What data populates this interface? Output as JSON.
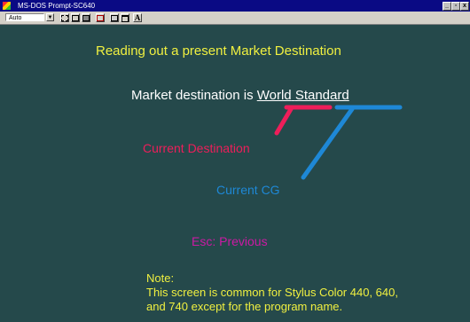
{
  "window": {
    "title": "MS-DOS Prompt-SC640",
    "controls": {
      "minimize": "_",
      "maximize": "▫",
      "close": "x"
    }
  },
  "toolbar": {
    "font_size_value": "Auto",
    "font_button_label": "A"
  },
  "console": {
    "heading": "Reading out a present Market Destination",
    "market_prefix": "Market destination is ",
    "market_world": "World",
    "market_space": " ",
    "market_standard": "Standard",
    "current_destination_label": "Current Destination",
    "current_cg_label": "Current CG",
    "esc_hint": "Esc:  Previous",
    "note_title": "Note:",
    "note_line1": "This screen is common for Stylus Color 440, 640,",
    "note_line2": "and 740 except for the program name."
  },
  "colors": {
    "background": "#25494b",
    "title_bar": "#0a0a84",
    "heading": "#f0f040",
    "destination_accent": "#ee1e5a",
    "cg_accent": "#1e88d6",
    "esc_hint": "#cc1aa4"
  }
}
